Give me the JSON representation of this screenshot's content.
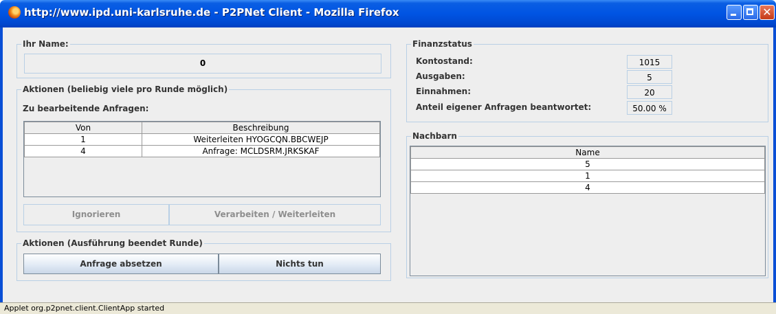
{
  "window": {
    "title": "http://www.ipd.uni-karlsruhe.de - P2PNet Client - Mozilla Firefox"
  },
  "name_panel": {
    "title": "Ihr Name:",
    "value": "0"
  },
  "actions_panel": {
    "title": "Aktionen (beliebig viele pro Runde möglich)",
    "requests_label": "Zu bearbeitende Anfragen:",
    "columns": [
      "Von",
      "Beschreibung"
    ],
    "rows": [
      {
        "von": "1",
        "beschreibung": "Weiterleiten HYOGCQN.BBCWEJP"
      },
      {
        "von": "4",
        "beschreibung": "Anfrage:  MCLDSRM.JRKSKAF"
      }
    ],
    "ignore_button": "Ignorieren",
    "process_button": "Verarbeiten / Weiterleiten"
  },
  "round_actions": {
    "title": "Aktionen (Ausführung beendet Runde)",
    "submit_button": "Anfrage absetzen",
    "nothing_button": "Nichts tun"
  },
  "finance": {
    "title": "Finanzstatus",
    "balance_label": "Kontostand:",
    "balance_value": "1015",
    "expenses_label": "Ausgaben:",
    "expenses_value": "5",
    "income_label": "Einnahmen:",
    "income_value": "20",
    "share_label": "Anteil eigener Anfragen beantwortet:",
    "share_value": "50.00 %"
  },
  "neighbors": {
    "title": "Nachbarn",
    "column": "Name",
    "rows": [
      "5",
      "1",
      "4"
    ]
  },
  "statusbar": {
    "text": "Applet org.p2pnet.client.ClientApp started"
  }
}
